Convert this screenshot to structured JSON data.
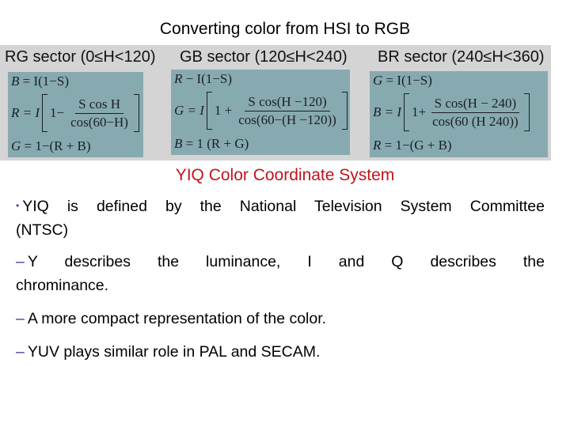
{
  "slide": {
    "title": "Converting color from HSI to RGB",
    "colors": {
      "band": "#d4d4d4",
      "formula_box": "#87aab0",
      "heading": "#c0141c",
      "bullet": "#4a48a8"
    },
    "sectors": [
      {
        "label": "RG sector (0≤H<120)",
        "eq1": {
          "lhs": "B",
          "rhs": "= I(1−S)"
        },
        "eq2": {
          "lhs": "R = I",
          "pre": "1−",
          "num": "S cos H",
          "den": "cos(60−H)"
        },
        "eq3": {
          "lhs": "G",
          "rhs": "= 1−(R + B)"
        }
      },
      {
        "label": "GB sector (120≤H<240)",
        "eq1": {
          "lhs": "R",
          "rhs": "− I(1−S)"
        },
        "eq2": {
          "lhs": "G = I",
          "pre": "1 +",
          "num": "S cos(H −120)",
          "den": "cos(60−(H −120))"
        },
        "eq3": {
          "lhs": "B",
          "rhs": "= 1   (R + G)"
        }
      },
      {
        "label": "BR sector (240≤H<360)",
        "eq1": {
          "lhs": "G",
          "rhs": "= I(1−S)"
        },
        "eq2": {
          "lhs": "B = I",
          "pre": "1+",
          "num": "S cos(H − 240)",
          "den": "cos(60   (H    240))"
        },
        "eq3": {
          "lhs": "R",
          "rhs": "= 1−(G + B)"
        }
      }
    ],
    "heading": "YIQ Color Coordinate System",
    "bullets": {
      "b1_symbol": "•",
      "b1_line1": "YIQ is defined by the National Television System Committee",
      "b1_line2": "(NTSC)",
      "dash_symbol": "–",
      "d1_line1": "Y describes the luminance, I and Q describes the",
      "d1_line2": "chrominance.",
      "d2": "A more compact representation of the color.",
      "d3": "YUV plays similar role in PAL and SECAM."
    }
  }
}
